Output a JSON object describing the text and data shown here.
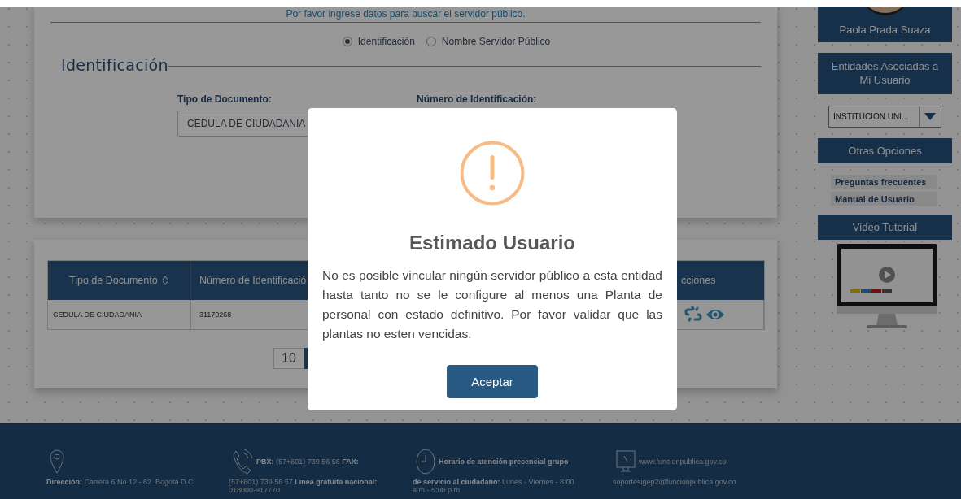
{
  "search_form": {
    "instructions": "Por favor ingrese datos para buscar el servidor público.",
    "search_by": [
      {
        "label": "Identificación",
        "selected": true
      },
      {
        "label": "Nombre Servidor Público",
        "selected": false
      }
    ],
    "section_title": "Identificación",
    "document_type": {
      "label": "Tipo de Documento:",
      "value": "CEDULA DE CIUDADANIA"
    },
    "id_number": {
      "label": "Número de Identificación:"
    }
  },
  "results_table": {
    "columns": [
      "Tipo de Documento",
      "Número de Identificació",
      "cciones"
    ],
    "rows": [
      {
        "cells": [
          "CEDULA DE CIUDADANIA",
          "31170268"
        ]
      }
    ],
    "page_size": "10"
  },
  "sidebar": {
    "user_name": "Paola Prada Suaza",
    "entities_title": "Entidades Asociadas a Mi Usuario",
    "entity_select": "INSTITUCION UNI...",
    "options_title": "Otras Opciones",
    "links": [
      "Preguntas frecuentes",
      "Manual de Usuario"
    ],
    "video_title": "Video Tutorial"
  },
  "dialog": {
    "title": "Estimado Usuario",
    "message": "No es posible vincular ningún servidor público a esta entidad hasta tanto no se le configure al menos una Planta de personal con estado definitivo. Por favor validar que las plantas no esten vencidas.",
    "button": "Aceptar"
  },
  "footer": [
    {
      "kind": "pin",
      "text": "**Dirección:** Carrera 6 No 12 - 62. Bogotá D.C."
    },
    {
      "kind": "phone",
      "heading": "**PBX:** (57+601) 739 56 56 **FAX:**",
      "text": "(57+601) 739 56 57 **Linea gratuita nacional:** 018000-917770"
    },
    {
      "kind": "clock",
      "heading": "**Horario de atención presencial grupo**",
      "text": "**de servicio al ciudadano:** Lunes - Viernes - 8:00 a.m - 5:00 p.m"
    },
    {
      "kind": "monitor",
      "heading": "www.funcionpublica.gov.co",
      "text": "soportesigep2@funcionpublica.gov.co"
    }
  ]
}
